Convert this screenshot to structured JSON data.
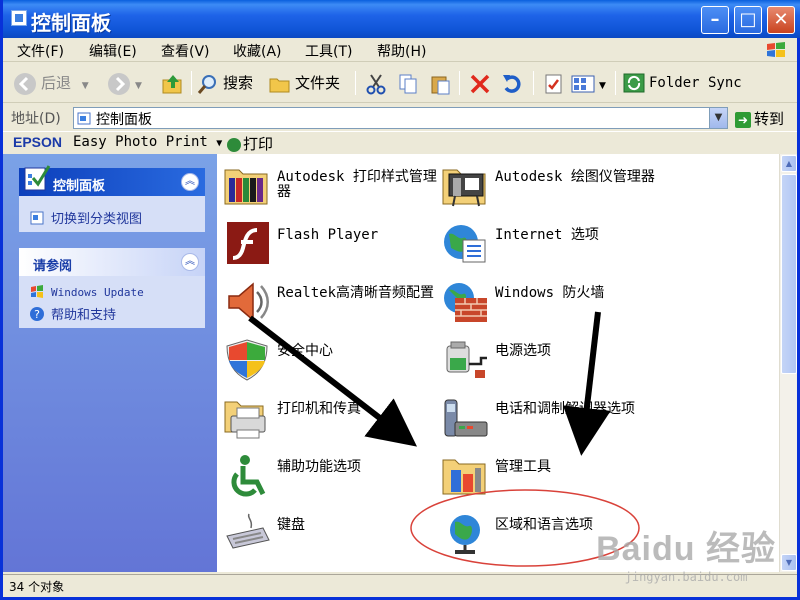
{
  "window": {
    "title": "控制面板"
  },
  "menu": [
    "文件(F)",
    "编辑(E)",
    "查看(V)",
    "收藏(A)",
    "工具(T)",
    "帮助(H)"
  ],
  "toolbar": {
    "back": "后退",
    "search": "搜索",
    "folders": "文件夹",
    "folder_sync": "Folder Sync"
  },
  "address": {
    "label": "地址(D)",
    "value": "控制面板",
    "go": "转到"
  },
  "epson": {
    "brand": "EPSON",
    "product": "Easy Photo Print",
    "print": "打印"
  },
  "sidebar": {
    "panel1": {
      "title": "控制面板",
      "link": "切换到分类视图"
    },
    "panel2": {
      "title": "请参阅",
      "links": [
        "Windows Update",
        "帮助和支持"
      ]
    }
  },
  "items": [
    "Autodesk 打印样式管理器",
    "Autodesk 绘图仪管理器",
    "Flash Player",
    "Internet 选项",
    "Realtek高清晰音频配置",
    "Windows 防火墙",
    "安全中心",
    "电源选项",
    "打印机和传真",
    "电话和调制解调器选项",
    "辅助功能选项",
    "管理工具",
    "键盘",
    "区域和语言选项"
  ],
  "status": {
    "count": "34 个对象"
  },
  "watermark": {
    "brand": "Baidu 经验",
    "url": "jingyan.baidu.com"
  },
  "colors": {
    "titlebar": "#0b49c2",
    "sidebar": "#6f8fe0",
    "annotation_ellipse": "#d9423a",
    "arrows": "#000000"
  }
}
